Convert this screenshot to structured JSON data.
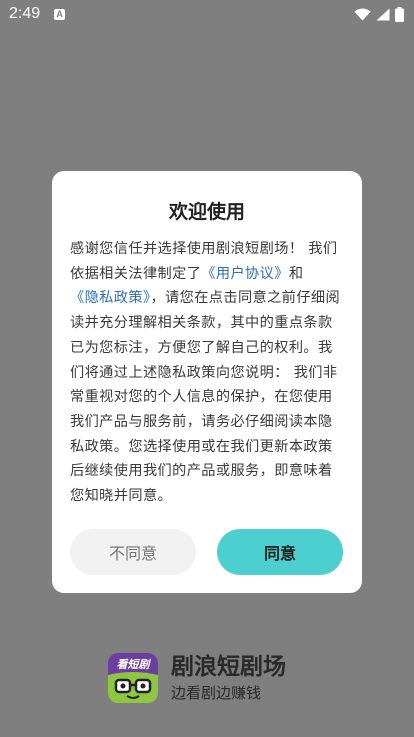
{
  "status_bar": {
    "time": "2:49",
    "notification_icon": "a-badge-icon",
    "icons": [
      "wifi-icon",
      "cellular-signal-icon",
      "battery-icon"
    ]
  },
  "dialog": {
    "title": "欢迎使用",
    "body": {
      "part1": "感谢您信任并选择使用剧浪短剧场！ 我们依据相关法律制定了",
      "link1": "《用户协议》",
      "part2": "和",
      "link2": "《隐私政策》",
      "part3": "，请您在点击同意之前仔细阅读并充分理解相关条款，其中的重点条款已为您标注，方便您了解自己的权利。我们将通过上述隐私政策向您说明： 我们非常重视对您的个人信息的保护，在您使用我们产品与服务前，请务必仔细阅读本隐私政策。您选择使用或在我们更新本政策后继续使用我们的产品或服务，即意味着您知晓并同意。"
    },
    "disagree_label": "不同意",
    "agree_label": "同意"
  },
  "brand": {
    "logo_text": "看短剧",
    "name": "剧浪短剧场",
    "slogan": "边看剧边赚钱"
  },
  "colors": {
    "overlay": "#7f7f7f",
    "link": "#2f6fb5",
    "agree_button": "#4dcfd0",
    "disagree_button": "#f1f1f1",
    "logo_purple": "#6b3fa0",
    "logo_green": "#8fc63f"
  }
}
